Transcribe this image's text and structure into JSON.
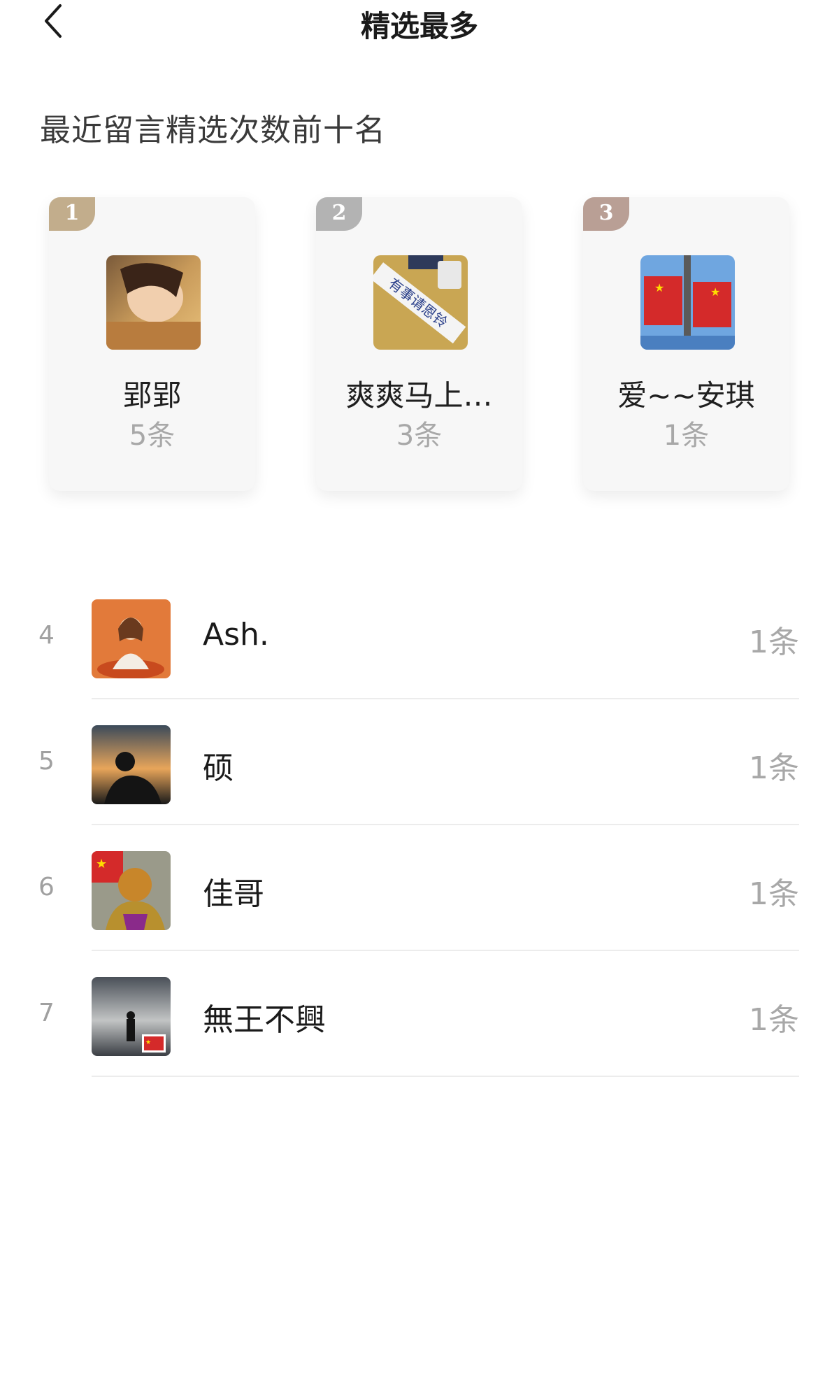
{
  "header": {
    "title": "精选最多"
  },
  "section": {
    "title": "最近留言精选次数前十名"
  },
  "top3": [
    {
      "rank": "1",
      "name": "郢郢",
      "count": "5条",
      "badge_color": "#c2ad8c"
    },
    {
      "rank": "2",
      "name": "爽爽马上…",
      "count": "3条",
      "badge_color": "#b3b3b3"
    },
    {
      "rank": "3",
      "name": "爱~~安琪",
      "count": "1条",
      "badge_color": "#b99f95"
    }
  ],
  "avatar_texts": {
    "rank2_sign": "有事请恩铃"
  },
  "ranks": [
    {
      "rank": "4",
      "name": "Ash.",
      "count": "1条"
    },
    {
      "rank": "5",
      "name": "硕",
      "count": "1条"
    },
    {
      "rank": "6",
      "name": "佳哥",
      "count": "1条"
    },
    {
      "rank": "7",
      "name": "無王不興",
      "count": "1条"
    }
  ],
  "colors": {
    "muted": "#a8a8a8",
    "divider": "#ececec",
    "card_bg": "#f7f7f7"
  },
  "icons": {
    "back": "chevron-left-icon"
  }
}
